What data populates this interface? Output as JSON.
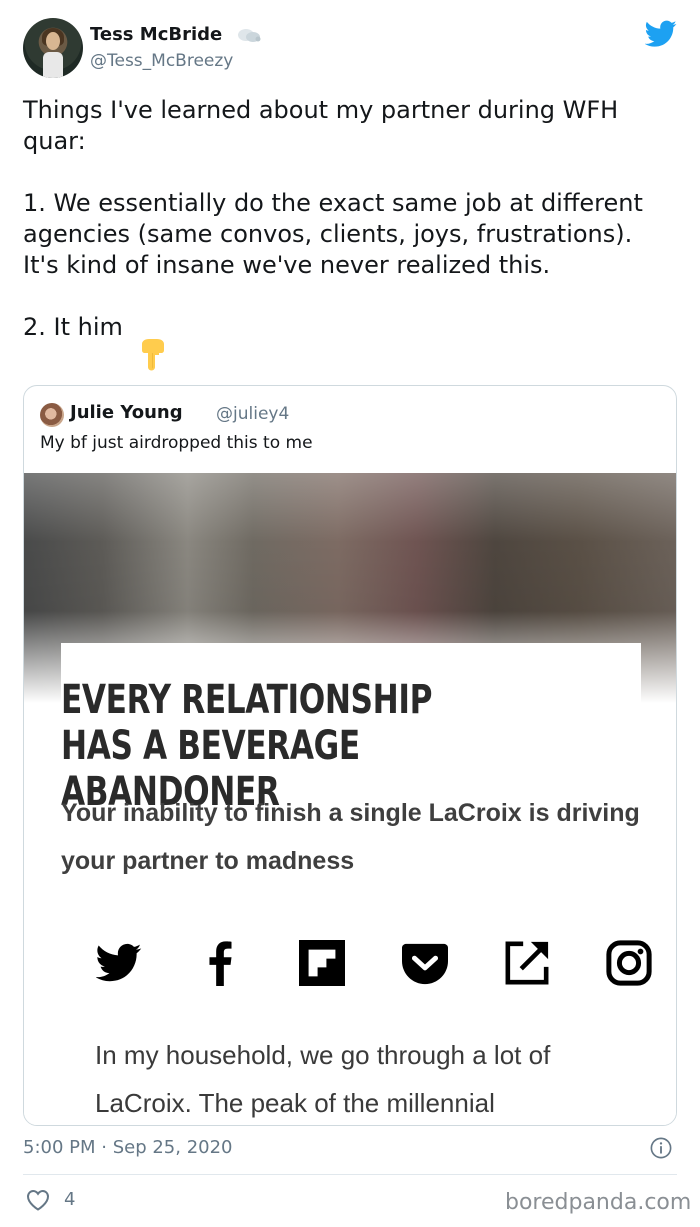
{
  "author": {
    "display_name": "Tess McBride",
    "handle": "@Tess_McBreezy",
    "name_emoji": "dash-emoji"
  },
  "brand_icon": "twitter-bird-icon",
  "tweet": {
    "line1": "Things I've learned about my partner during WFH quar:",
    "line2": "1. We essentially do the exact same job at different agencies (same convos, clients, joys, frustrations). It's kind of insane we've never realized this.",
    "line3": "2. It him",
    "emoji": "backhand-index-pointing-down"
  },
  "quoted_tweet": {
    "display_name": "Julie Young",
    "handle": "@juliey4",
    "text": "My bf just airdropped this to me",
    "article": {
      "headline": "EVERY RELATIONSHIP HAS A BEVERAGE ABANDONER",
      "subhead": "Your inability to finish a single LaCroix is driving your partner to madness",
      "share_icons": [
        "twitter-icon",
        "facebook-icon",
        "flipboard-icon",
        "pocket-icon",
        "external-link-icon",
        "instagram-icon"
      ],
      "excerpt": "In my household, we go through a lot of LaCroix. The peak of the millennial"
    }
  },
  "footer": {
    "timestamp": "5:00 PM · Sep 25, 2020",
    "likes": "4",
    "watermark": "boredpanda.com"
  },
  "colors": {
    "twitter_blue": "#1da1f2",
    "secondary_text": "#657786",
    "border": "#cfd9de"
  }
}
